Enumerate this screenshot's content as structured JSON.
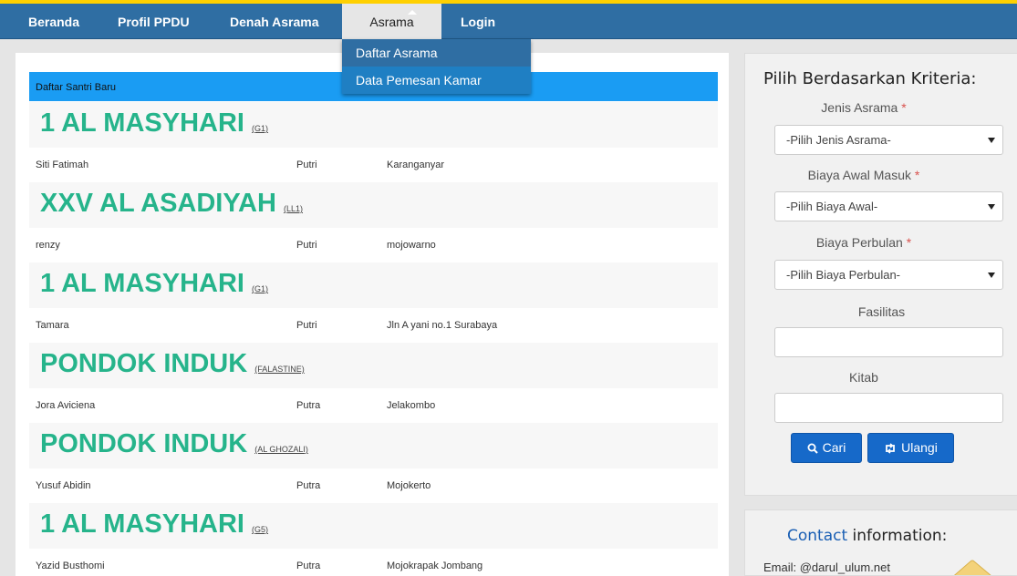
{
  "nav": {
    "items": [
      "Beranda",
      "Profil PPDU",
      "Denah Asrama",
      "Asrama",
      "Login"
    ],
    "dropdown": [
      "Daftar Asrama",
      "Data Pemesan Kamar"
    ]
  },
  "main": {
    "header": "Daftar Santri Baru",
    "groups": [
      {
        "dorm": "1 AL MASYHARI",
        "code": "(G1)",
        "name": "Siti Fatimah",
        "gender": "Putri",
        "address": "Karanganyar"
      },
      {
        "dorm": "XXV AL ASADIYAH",
        "code": "(LL1)",
        "name": "renzy",
        "gender": "Putri",
        "address": "mojowarno"
      },
      {
        "dorm": "1 AL MASYHARI",
        "code": "(G1)",
        "name": "Tamara",
        "gender": "Putri",
        "address": "Jln A yani no.1 Surabaya"
      },
      {
        "dorm": "PONDOK INDUK",
        "code": "(FALASTINE)",
        "name": "Jora Aviciena",
        "gender": "Putra",
        "address": "Jelakombo"
      },
      {
        "dorm": "PONDOK INDUK",
        "code": "(AL GHOZALI)",
        "name": "Yusuf Abidin",
        "gender": "Putra",
        "address": "Mojokerto"
      },
      {
        "dorm": "1 AL MASYHARI",
        "code": "(G5)",
        "name": "Yazid Busthomi",
        "gender": "Putra",
        "address": "Mojokrapak Jombang"
      }
    ]
  },
  "sidebar": {
    "title": "Pilih Berdasarkan Kriteria:",
    "jenis_label": "Jenis Asrama",
    "jenis_value": "-Pilih Jenis Asrama-",
    "biaya_awal_label": "Biaya Awal Masuk",
    "biaya_awal_value": "-Pilih Biaya Awal-",
    "biaya_bulan_label": "Biaya Perbulan",
    "biaya_bulan_value": "-Pilih Biaya Perbulan-",
    "fasilitas_label": "Fasilitas",
    "kitab_label": "Kitab",
    "required_mark": "*",
    "search_button": "Cari",
    "reset_button": "Ulangi"
  },
  "contact": {
    "title_highlight": "Contact",
    "title_rest": "information:",
    "email": "Email: @darul_ulum.net"
  },
  "colors": {
    "navbar": "#2f6ea3",
    "accent_bar": "#ffd000",
    "table_header": "#1a9cf3",
    "dorm_name": "#26b48b",
    "button": "#1669c9"
  },
  "icons": [
    "search-icon",
    "retweet-icon",
    "envelope-icon",
    "caret-up-icon",
    "select-arrow-icon"
  ]
}
